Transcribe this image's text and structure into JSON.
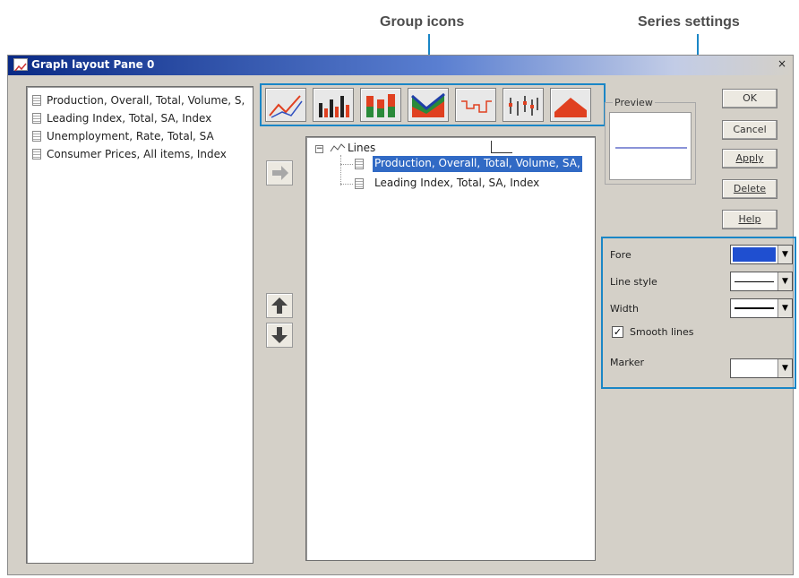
{
  "callouts": {
    "group_icons": "Group icons",
    "series_settings": "Series settings"
  },
  "window": {
    "title": "Graph layout Pane 0",
    "close": "×"
  },
  "available_series": [
    "Production, Overall, Total, Volume, S,",
    "Leading Index, Total, SA, Index",
    "Unemployment, Rate, Total, SA",
    "Consumer Prices, All items, Index"
  ],
  "group_icons": [
    "line-chart-icon",
    "bar-chart-icon",
    "stacked-bar-icon",
    "area-chart-icon",
    "step-chart-icon",
    "high-low-icon",
    "filled-area-icon"
  ],
  "tree": {
    "group_label": "Lines",
    "items": [
      "Production, Overall, Total, Volume, SA,",
      "Leading Index, Total, SA, Index"
    ],
    "selected_index": 0
  },
  "preview": {
    "label": "Preview",
    "line_color": "#8a93d8"
  },
  "buttons": {
    "ok": "OK",
    "cancel": "Cancel",
    "apply": "Apply",
    "delete": "Delete",
    "help": "Help"
  },
  "settings": {
    "fore_label": "Fore",
    "fore_color": "#1f4fd0",
    "line_style_label": "Line style",
    "width_label": "Width",
    "smooth_lines_label": "Smooth lines",
    "smooth_lines_checked": true,
    "marker_label": "Marker"
  },
  "colors": {
    "callout": "#1a86c6",
    "selection": "#316ac5"
  }
}
